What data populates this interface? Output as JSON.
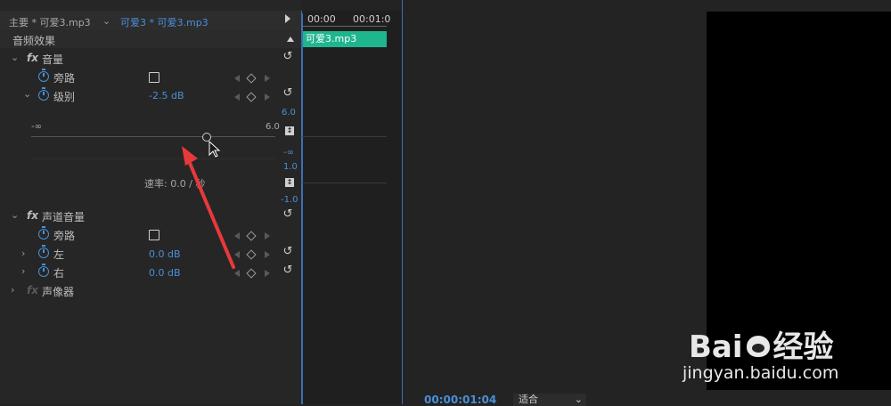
{
  "tabs": {
    "primary": "主要 * 可爱3.mp3",
    "active": "可爱3 * 可爱3.mp3",
    "chevron": "chevron-down-icon"
  },
  "timeline": {
    "time_start": "00:00",
    "time_end": "00:01:0",
    "clip_name": "可爱3.mp3",
    "clip_color": "#1fb58d"
  },
  "section": {
    "title": "音频效果"
  },
  "volume": {
    "fx": "fx",
    "name": "音量",
    "bypass_label": "旁路",
    "level_label": "级别",
    "level_value": "-2.5 dB"
  },
  "slider": {
    "min_label": "-∞",
    "max_label": "6.0",
    "level_fraction": 0.72,
    "graph_top": "6.0",
    "graph_bottom": "-∞",
    "rate_top": "1.0",
    "rate_bottom": "-1.0",
    "rate_label": "速率: 0.0 / 秒"
  },
  "channel_volume": {
    "fx": "fx",
    "name": "声道音量",
    "bypass_label": "旁路",
    "left_label": "左",
    "left_value": "0.0 dB",
    "right_label": "右",
    "right_value": "0.0 dB"
  },
  "panner": {
    "fx": "fx",
    "name": "声像器"
  },
  "program": {
    "timecode": "00:00:01:04",
    "fit_label": "适合"
  },
  "watermark": {
    "logo": "Bai 经验",
    "url": "jingyan.baidu.com"
  },
  "colors": {
    "accent": "#4a8fd8",
    "panel": "#262626",
    "arrow": "#e8393a"
  }
}
